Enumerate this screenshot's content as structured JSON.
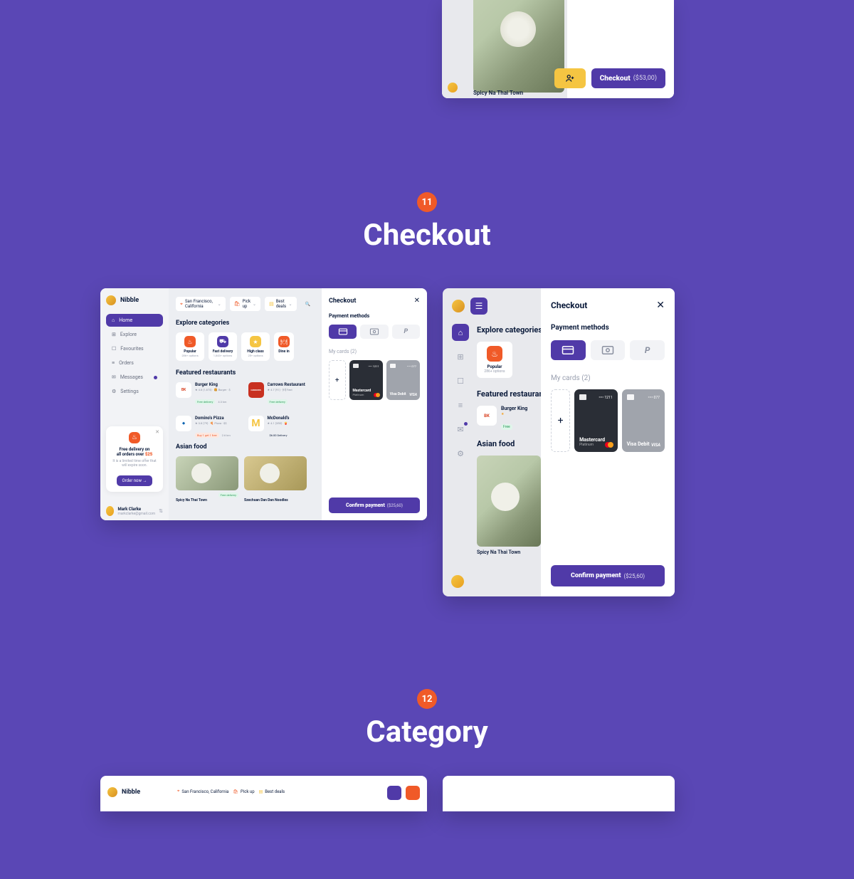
{
  "sections": {
    "s11": {
      "badge": "11",
      "title": "Checkout"
    },
    "s12": {
      "badge": "12",
      "title": "Category"
    }
  },
  "top_preview": {
    "food_title": "Spicy Na Thai Town",
    "checkout_label": "Checkout",
    "checkout_price": "($53,00)"
  },
  "app": {
    "brand": "Nibble",
    "nav": [
      {
        "icon": "⌂",
        "label": "Home",
        "active": true
      },
      {
        "icon": "⊞",
        "label": "Explore"
      },
      {
        "icon": "☐",
        "label": "Favourites"
      },
      {
        "icon": "≡",
        "label": "Orders"
      },
      {
        "icon": "✉",
        "label": "Messages",
        "badge": true
      },
      {
        "icon": "⚙",
        "label": "Settings"
      }
    ],
    "promo": {
      "line1_a": "Free delivery on",
      "line1_b": "all orders over",
      "amount": "$25",
      "line2": "It is a limited time offer that will expire soon.",
      "button": "Order now →"
    },
    "user": {
      "name": "Mark Clarke",
      "email": "markclarke@gmail.com"
    },
    "filters": {
      "location": "San Francisco, California",
      "mode": "Pick up",
      "deals": "Best deals"
    },
    "headings": {
      "categories": "Explore categories",
      "featured": "Featured restaurants",
      "asian": "Asian food"
    },
    "categories": [
      {
        "name": "Popular",
        "options": "286+ options",
        "color": "#f05a28",
        "icon": "♨"
      },
      {
        "name": "Fast delivery",
        "options": "1,843+ options",
        "color": "#503aa8",
        "icon": "⛟"
      },
      {
        "name": "High class",
        "options": "25+ options",
        "color": "#f5c542",
        "icon": "★"
      },
      {
        "name": "Dine in",
        "options": "182+ options",
        "color": "#f05a28",
        "icon": "🍽"
      }
    ],
    "restaurants": [
      {
        "name": "Burger King",
        "meta": "★ 4.8 (1,873) · 🍔 Burger · $",
        "meta2": "Free delivery · 4.3 km",
        "tag": "Free delivery",
        "tag_type": "fd",
        "logo": "BK",
        "logo_bg": "#fff"
      },
      {
        "name": "Carrows Restaurant",
        "meta": "★ 4.7 (91) · 🍽 Fast",
        "meta2": "Free delivery",
        "tag": "Free delivery",
        "tag_type": "fd",
        "logo": "CARROWS",
        "logo_bg": "#c83020"
      },
      {
        "name": "Domino's Pizza",
        "meta": "★ 3.8 (79) · 🍕 Pizza · $$",
        "meta2": "Buy 1 get 1 free · 2.6 km",
        "tag": "Buy 1 get 1 free",
        "tag_type": "bo",
        "logo": "◆",
        "logo_bg": "#fff"
      },
      {
        "name": "McDonald's",
        "meta": "★ 4.1 (358) · 🍟",
        "meta2": "$6.00 Delivery",
        "tag": "$6.00 Delivery",
        "tag_type": "",
        "logo": "M",
        "logo_bg": "#fff"
      }
    ],
    "foods": [
      {
        "name": "Spicy Na Thai Town",
        "tag": "Free delivery"
      },
      {
        "name": "Szechuan Dan Dan Noodles",
        "tag": ""
      }
    ]
  },
  "checkout": {
    "title": "Checkout",
    "payment_methods_label": "Payment methods",
    "my_cards_label": "My cards",
    "my_cards_count": "(2)",
    "methods": [
      {
        "id": "card",
        "icon": "▭",
        "active": true
      },
      {
        "id": "cash",
        "icon": "$",
        "active": false
      },
      {
        "id": "paypal",
        "icon": "P",
        "active": false
      }
    ],
    "cards": [
      {
        "name": "Mastercard",
        "subtitle": "Platinum",
        "last4": "1211",
        "brand": "mc"
      },
      {
        "name": "Visa Debit",
        "subtitle": "",
        "last4": "077",
        "brand": "visa"
      }
    ],
    "confirm_label": "Confirm payment",
    "confirm_price": "($25,60)"
  },
  "tablet": {
    "categories_heading": "Explore categories",
    "category": {
      "name": "Popular",
      "options": "286+ options"
    },
    "featured_heading": "Featured restaurants",
    "restaurant": {
      "name": "Burger King",
      "meta": "★",
      "tag": "Free"
    },
    "asian_heading": "Asian food",
    "food_title": "Spicy Na Thai Town"
  }
}
